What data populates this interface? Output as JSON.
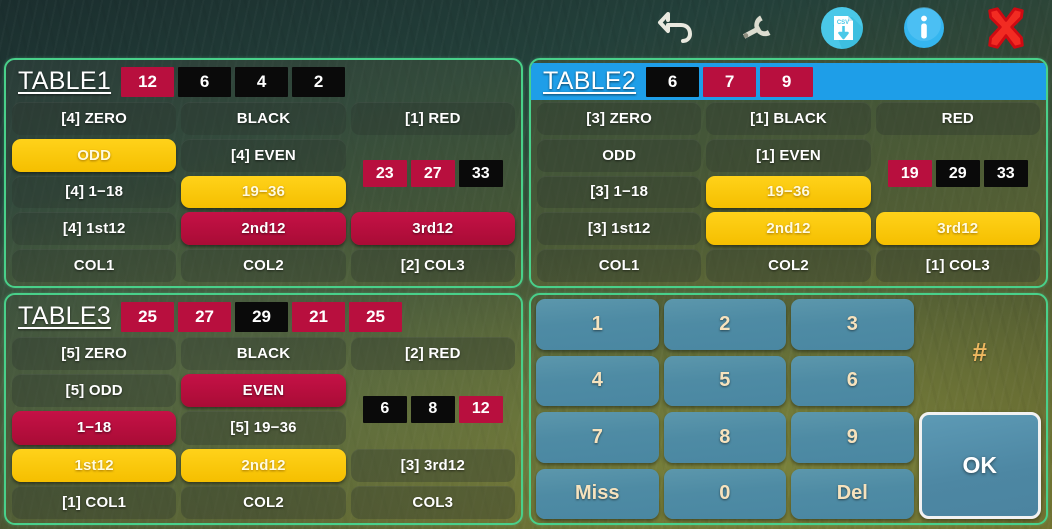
{
  "toolbar": {
    "items": [
      {
        "name": "undo-icon",
        "label": "Undo"
      },
      {
        "name": "wrench-icon",
        "label": "Settings"
      },
      {
        "name": "csv-download-icon",
        "label": "CSV",
        "badge": "csv"
      },
      {
        "name": "info-icon",
        "label": "Info"
      },
      {
        "name": "close-icon",
        "label": "Close"
      }
    ]
  },
  "tables": [
    {
      "title": "TABLE1",
      "active": false,
      "history": [
        {
          "value": "12",
          "color": "red"
        },
        {
          "value": "6",
          "color": "black"
        },
        {
          "value": "4",
          "color": "black"
        },
        {
          "value": "2",
          "color": "black"
        }
      ],
      "bets": [
        {
          "label": "[4] ZERO",
          "state": "off"
        },
        {
          "label": "BLACK",
          "state": "off"
        },
        {
          "label": "[1] RED",
          "state": "off"
        },
        {
          "label": "ODD",
          "state": "yellow"
        },
        {
          "label": "[4] EVEN",
          "state": "off"
        },
        {
          "label": "[4] 1−18",
          "state": "off"
        },
        {
          "label": "19−36",
          "state": "yellow"
        },
        {
          "label": "[4] 1st12",
          "state": "off"
        },
        {
          "label": "2nd12",
          "state": "red"
        },
        {
          "label": "3rd12",
          "state": "red"
        },
        {
          "label": "COL1",
          "state": "off"
        },
        {
          "label": "COL2",
          "state": "off"
        },
        {
          "label": "[2] COL3",
          "state": "off"
        }
      ],
      "recent": [
        {
          "value": "23",
          "color": "red"
        },
        {
          "value": "27",
          "color": "red"
        },
        {
          "value": "33",
          "color": "black"
        }
      ]
    },
    {
      "title": "TABLE2",
      "active": true,
      "history": [
        {
          "value": "6",
          "color": "black"
        },
        {
          "value": "7",
          "color": "red"
        },
        {
          "value": "9",
          "color": "red"
        }
      ],
      "bets": [
        {
          "label": "[3] ZERO",
          "state": "off"
        },
        {
          "label": "[1] BLACK",
          "state": "off"
        },
        {
          "label": "RED",
          "state": "off"
        },
        {
          "label": "ODD",
          "state": "off"
        },
        {
          "label": "[1] EVEN",
          "state": "off"
        },
        {
          "label": "[3] 1−18",
          "state": "off"
        },
        {
          "label": "19−36",
          "state": "yellow"
        },
        {
          "label": "[3] 1st12",
          "state": "off"
        },
        {
          "label": "2nd12",
          "state": "yellow"
        },
        {
          "label": "3rd12",
          "state": "yellow"
        },
        {
          "label": "COL1",
          "state": "off"
        },
        {
          "label": "COL2",
          "state": "off"
        },
        {
          "label": "[1] COL3",
          "state": "off"
        }
      ],
      "recent": [
        {
          "value": "19",
          "color": "red"
        },
        {
          "value": "29",
          "color": "black"
        },
        {
          "value": "33",
          "color": "black"
        }
      ]
    },
    {
      "title": "TABLE3",
      "active": false,
      "history": [
        {
          "value": "25",
          "color": "red"
        },
        {
          "value": "27",
          "color": "red"
        },
        {
          "value": "29",
          "color": "black"
        },
        {
          "value": "21",
          "color": "red"
        },
        {
          "value": "25",
          "color": "red"
        }
      ],
      "bets": [
        {
          "label": "[5] ZERO",
          "state": "off"
        },
        {
          "label": "BLACK",
          "state": "off"
        },
        {
          "label": "[2] RED",
          "state": "off"
        },
        {
          "label": "[5] ODD",
          "state": "off"
        },
        {
          "label": "EVEN",
          "state": "red"
        },
        {
          "label": "1−18",
          "state": "red"
        },
        {
          "label": "[5] 19−36",
          "state": "off"
        },
        {
          "label": "1st12",
          "state": "yellow"
        },
        {
          "label": "2nd12",
          "state": "yellow"
        },
        {
          "label": "[3] 3rd12",
          "state": "off"
        },
        {
          "label": "[1] COL1",
          "state": "off"
        },
        {
          "label": "COL2",
          "state": "off"
        },
        {
          "label": "COL3",
          "state": "off"
        }
      ],
      "recent": [
        {
          "value": "6",
          "color": "black"
        },
        {
          "value": "8",
          "color": "black"
        },
        {
          "value": "12",
          "color": "red"
        }
      ]
    }
  ],
  "keypad": {
    "keys": [
      "1",
      "2",
      "3",
      "4",
      "5",
      "6",
      "7",
      "8",
      "9",
      "Miss",
      "0",
      "Del"
    ],
    "display": "#",
    "ok_label": "OK"
  },
  "colors": {
    "red": "#b80f3e",
    "black": "#0a0a0a",
    "yellow": "#ffd21a",
    "active_header": "#1e9ee8",
    "panel_border": "#49d08a",
    "key_blue": "#4e8ba4",
    "hash_orange": "#eeb860"
  }
}
